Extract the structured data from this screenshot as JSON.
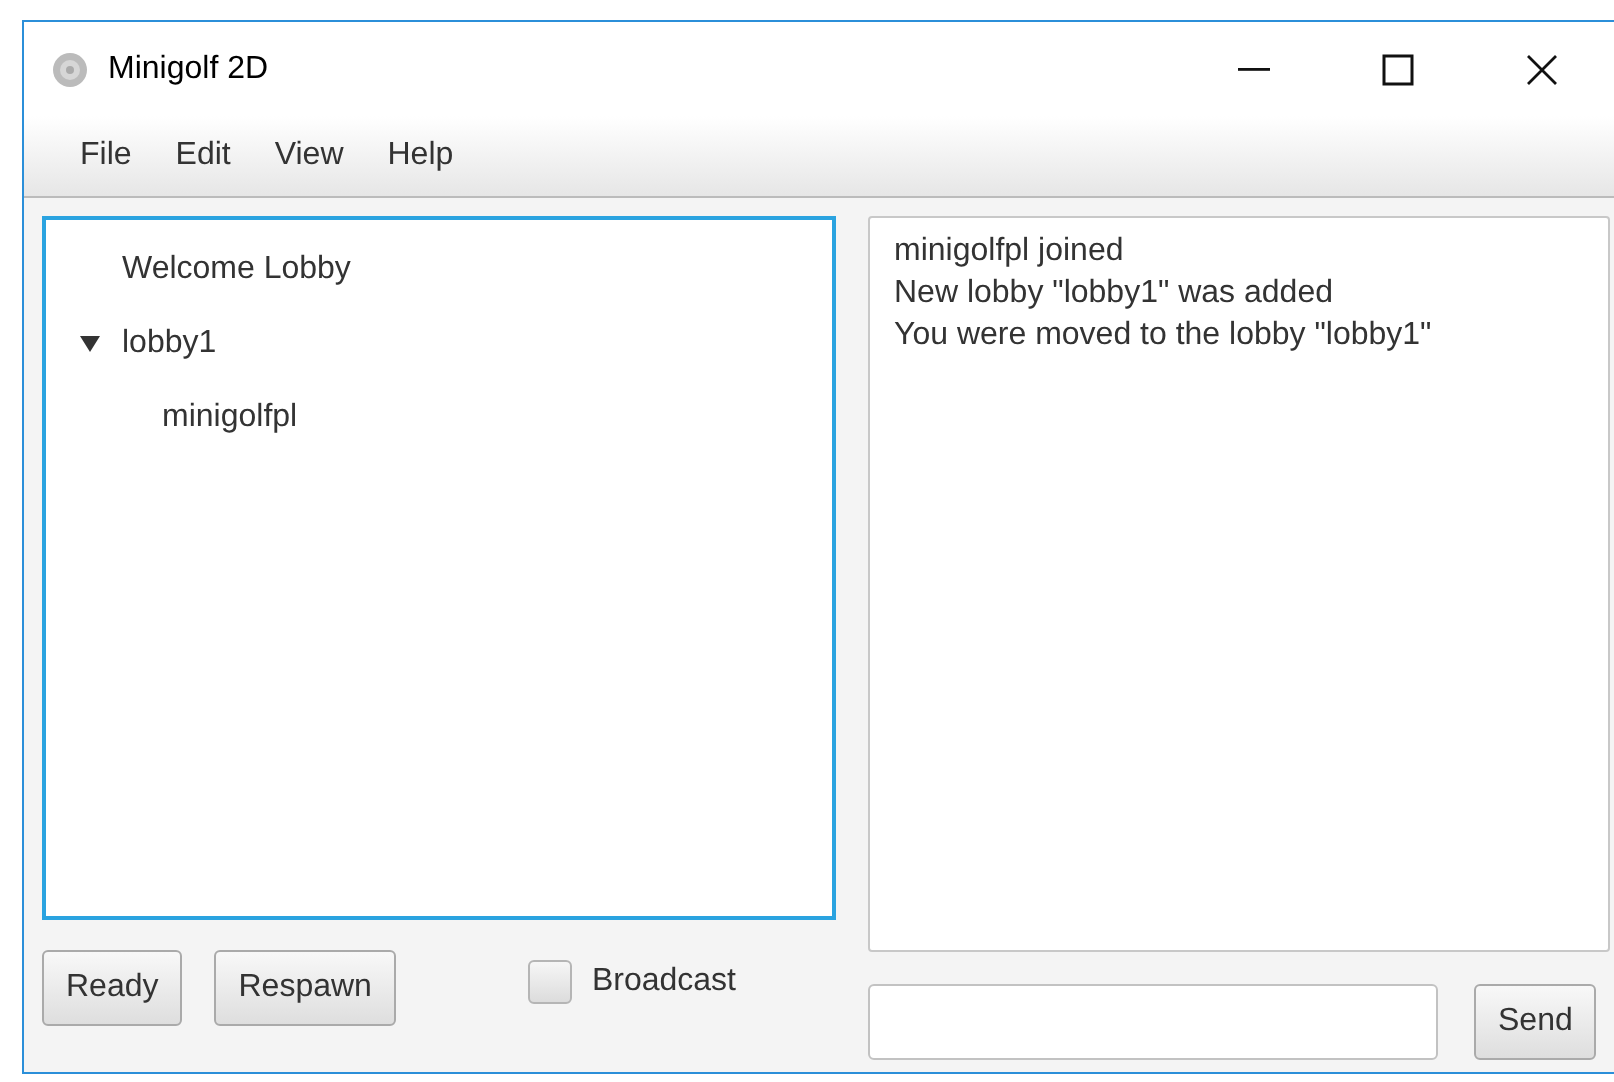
{
  "window": {
    "title": "Minigolf 2D"
  },
  "menu": [
    "File",
    "Edit",
    "View",
    "Help"
  ],
  "lobby_tree": [
    {
      "label": "Welcome Lobby"
    },
    {
      "label": "lobby1",
      "expanded": true,
      "children": [
        {
          "label": "minigolfpl"
        }
      ]
    }
  ],
  "chat_log": [
    "minigolfpl joined",
    "New lobby \"lobby1\" was added",
    "You were moved to the lobby \"lobby1\""
  ],
  "buttons": [
    "Ready",
    "Respawn"
  ],
  "broadcast": {
    "label": "Broadcast",
    "checked": false
  },
  "send_button": "Send"
}
